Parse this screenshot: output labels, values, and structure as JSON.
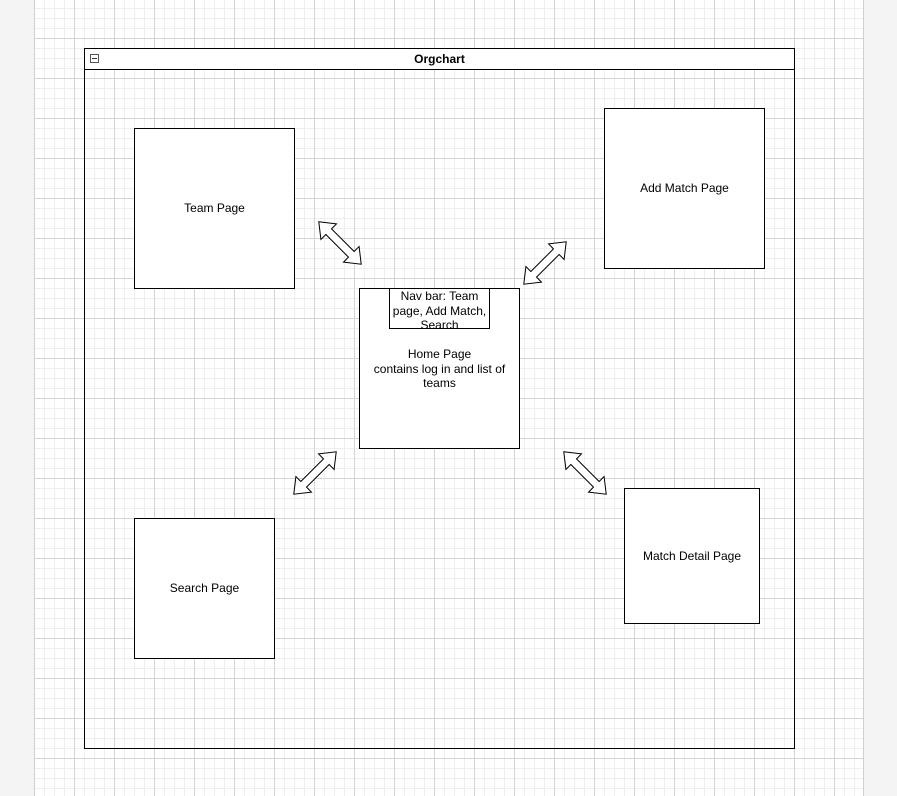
{
  "container": {
    "title": "Orgchart"
  },
  "nodes": {
    "team": "Team Page",
    "add_match": "Add Match Page",
    "search": "Search Page",
    "match_detail": "Match Detail Page",
    "home": "Home Page\ncontains log in and list of teams",
    "navbar": "Nav bar: Team page, Add Match, Search"
  },
  "colors": {
    "stroke": "#000000",
    "fill": "#ffffff",
    "grid": "#d4d4d4",
    "background": "#f4f4f4"
  },
  "icons": {
    "collapse": "collapse-minus-icon",
    "connector": "double-headed-arrow"
  }
}
